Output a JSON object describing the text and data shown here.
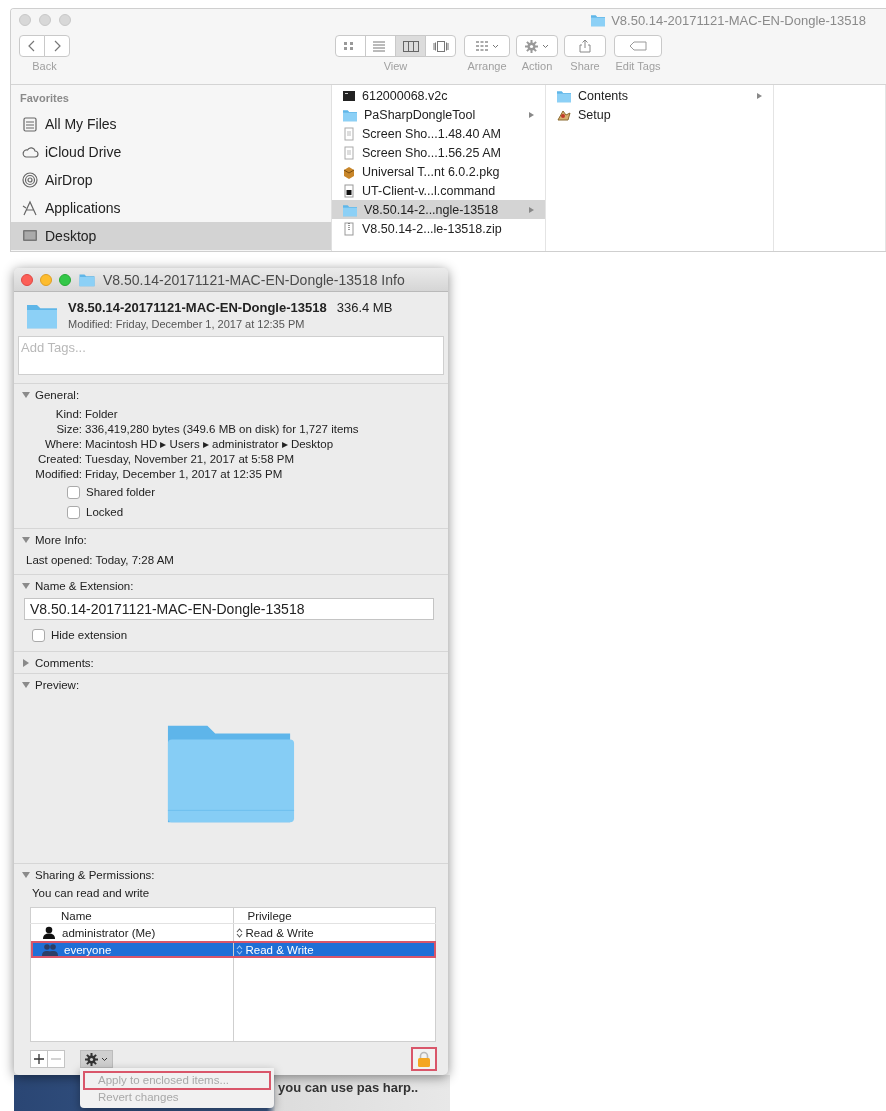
{
  "finder": {
    "title": "V8.50.14-20171121-MAC-EN-Dongle-13518",
    "toolbar": {
      "back_label": "Back",
      "view_label": "View",
      "view_modes": [
        {
          "selected": false
        },
        {
          "selected": false
        },
        {
          "selected": true
        },
        {
          "selected": false
        }
      ],
      "arrange_label": "Arrange",
      "action_label": "Action",
      "share_label": "Share",
      "edit_tags_label": "Edit Tags"
    },
    "sidebar": {
      "heading": "Favorites",
      "items": [
        {
          "label": "All My Files",
          "kind": "files",
          "selected": false
        },
        {
          "label": "iCloud Drive",
          "kind": "cloud",
          "selected": false
        },
        {
          "label": "AirDrop",
          "kind": "airdrop",
          "selected": false
        },
        {
          "label": "Applications",
          "kind": "apps",
          "selected": false
        },
        {
          "label": "Desktop",
          "kind": "desktop",
          "selected": true
        }
      ]
    },
    "columns": [
      {
        "items": [
          {
            "name": "612000068.v2c",
            "kind": "binary",
            "has_children": false,
            "selected": false
          },
          {
            "name": "PaSharpDongleTool",
            "kind": "folder",
            "has_children": true,
            "selected": false
          },
          {
            "name": "Screen Sho...1.48.40 AM",
            "kind": "image",
            "has_children": false,
            "selected": false
          },
          {
            "name": "Screen Sho...1.56.25 AM",
            "kind": "image",
            "has_children": false,
            "selected": false
          },
          {
            "name": "Universal T...nt 6.0.2.pkg",
            "kind": "package",
            "has_children": false,
            "selected": false
          },
          {
            "name": "UT-Client-v...l.command",
            "kind": "script",
            "has_children": false,
            "selected": false
          },
          {
            "name": "V8.50.14-2...ngle-13518",
            "kind": "folder",
            "has_children": true,
            "selected": true
          },
          {
            "name": "V8.50.14-2...le-13518.zip",
            "kind": "zip",
            "has_children": false,
            "selected": false
          }
        ]
      },
      {
        "items": [
          {
            "name": "Contents",
            "kind": "folder",
            "has_children": true,
            "selected": false
          },
          {
            "name": "Setup",
            "kind": "app",
            "has_children": false,
            "selected": false
          }
        ]
      }
    ]
  },
  "info": {
    "title": "V8.50.14-20171121-MAC-EN-Dongle-13518 Info",
    "name": "V8.50.14-20171121-MAC-EN-Dongle-13518",
    "size": "336.4 MB",
    "modified": "Modified: Friday, December 1, 2017 at 12:35 PM",
    "tags": {
      "placeholder": "Add Tags..."
    },
    "sections": [
      {
        "kind": "general",
        "title": "General:",
        "expanded": true,
        "properties": [
          {
            "label": "Kind:",
            "value": "Folder"
          },
          {
            "label": "Size:",
            "value": "336,419,280 bytes (349.6 MB on disk) for 1,727 items"
          },
          {
            "label": "Where:",
            "value": "Macintosh HD ▸ Users ▸ administrator ▸ Desktop"
          },
          {
            "label": "Created:",
            "value": "Tuesday, November 21, 2017 at 5:58 PM"
          },
          {
            "label": "Modified:",
            "value": "Friday, December 1, 2017 at 12:35 PM"
          }
        ],
        "checkboxes": [
          {
            "label": "Shared folder",
            "checked": false
          },
          {
            "label": "Locked",
            "checked": false
          }
        ]
      },
      {
        "kind": "more_info",
        "title": "More Info:",
        "expanded": true,
        "text": "Last opened: Today, 7:28 AM"
      },
      {
        "kind": "name",
        "title": "Name & Extension:",
        "expanded": true,
        "value": "V8.50.14-20171121-MAC-EN-Dongle-13518",
        "checkboxes": [
          {
            "label": "Hide extension",
            "checked": false
          }
        ]
      },
      {
        "title": "Comments:",
        "expanded": false
      },
      {
        "kind": "preview",
        "title": "Preview:",
        "expanded": true
      },
      {
        "kind": "sharing",
        "title": "Sharing & Permissions:",
        "expanded": true,
        "text": "You can read and write",
        "columns": [
          "Name",
          "Privilege"
        ],
        "rows": [
          {
            "name": "administrator (Me)",
            "kind": "user",
            "privilege": "Read & Write",
            "selected": false,
            "highlighted": false
          },
          {
            "name": "everyone",
            "kind": "group",
            "privilege": "Read & Write",
            "selected": true,
            "highlighted": true
          }
        ],
        "lock": {
          "highlighted": true
        }
      }
    ],
    "action_menu": {
      "items": [
        {
          "label": "Apply to enclosed items...",
          "disabled": true,
          "highlighted": true
        },
        {
          "label": "Revert changes",
          "disabled": true,
          "highlighted": false
        }
      ]
    }
  },
  "background_text": "you can use pas harp.."
}
